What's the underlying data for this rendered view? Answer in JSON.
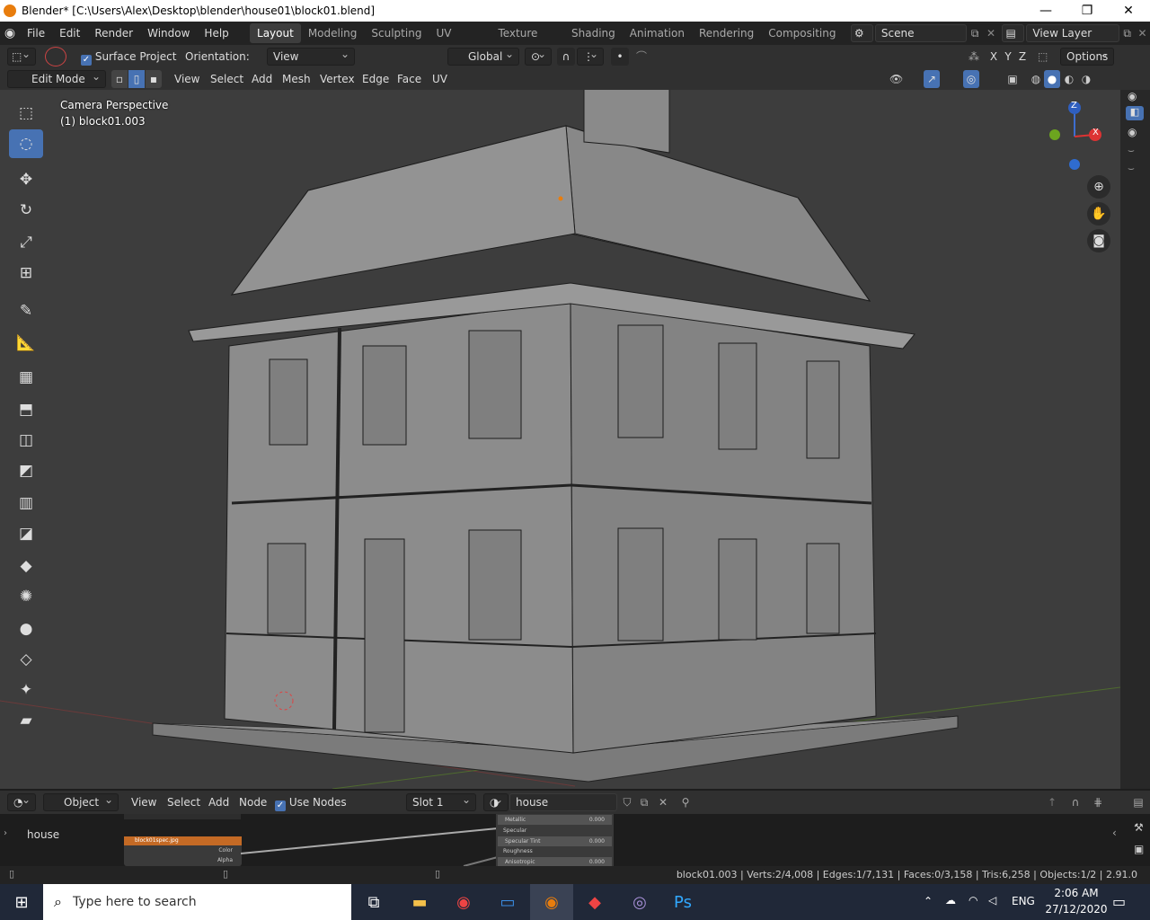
{
  "window": {
    "title": "Blender* [C:\\Users\\Alex\\Desktop\\blender\\house01\\block01.blend]",
    "min": "—",
    "max": "❐",
    "close": "✕"
  },
  "menus": [
    "File",
    "Edit",
    "Render",
    "Window",
    "Help"
  ],
  "workspaces": [
    "Layout",
    "Modeling",
    "Sculpting",
    "UV Editing",
    "Texture Paint",
    "Shading",
    "Animation",
    "Rendering",
    "Compositing"
  ],
  "scene": "Scene",
  "view_layer": "View Layer",
  "tool_header": {
    "surface_project": "Surface Project",
    "orientation_label": "Orientation:",
    "orientation_value": "View",
    "transform_orientation": "Global",
    "axes": [
      "X",
      "Y",
      "Z"
    ],
    "options": "Options"
  },
  "editor_header": {
    "mode": "Edit Mode",
    "menus": [
      "View",
      "Select",
      "Add",
      "Mesh",
      "Vertex",
      "Edge",
      "Face",
      "UV"
    ]
  },
  "viewport": {
    "camera": "Camera Perspective",
    "object": "(1) block01.003",
    "gizmo": {
      "z": "Z",
      "x": "X"
    }
  },
  "node_header": {
    "editor_type": "Object",
    "menus": [
      "View",
      "Select",
      "Add",
      "Node"
    ],
    "use_nodes": "Use Nodes",
    "slot": "Slot 1",
    "material": "house"
  },
  "node_area": {
    "label": "house",
    "image_node": "block01spec.jpg",
    "image_sockets": [
      "Color",
      "Alpha"
    ],
    "bsdf_rows": [
      {
        "name": "Metallic",
        "value": "0.000"
      },
      {
        "name": "Specular",
        "value": ""
      },
      {
        "name": "Specular Tint",
        "value": "0.000"
      },
      {
        "name": "Roughness",
        "value": ""
      },
      {
        "name": "Anisotropic",
        "value": "0.000"
      }
    ]
  },
  "status": "block01.003 | Verts:2/4,008 | Edges:1/7,131 | Faces:0/3,158 | Tris:6,258 | Objects:1/2 | 2.91.0",
  "taskbar": {
    "search_placeholder": "Type here to search",
    "lang": "ENG",
    "time": "2:06 AM",
    "date": "27/12/2020"
  },
  "colors": {
    "accent": "#4772b3",
    "active_orange": "#e87d0d"
  }
}
